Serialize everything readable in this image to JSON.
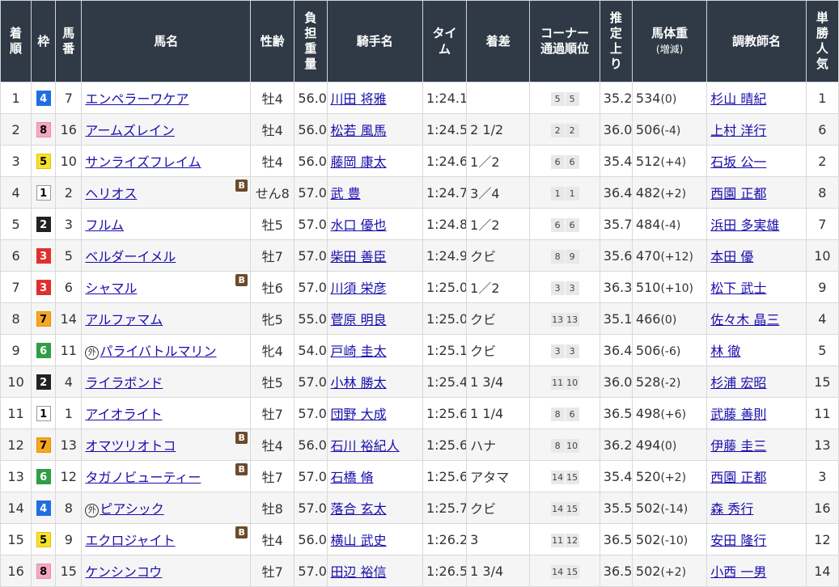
{
  "headers": {
    "rank": "着順",
    "waku": "枠",
    "num": "馬番",
    "horse": "馬名",
    "sexage": "性齢",
    "weight": "負担重量",
    "jockey": "騎手名",
    "time": "タイム",
    "margin": "着差",
    "corner_line1": "コーナー",
    "corner_line2": "通過順位",
    "last": "推定上り",
    "bw_line1": "馬体重",
    "bw_line2": "(増減)",
    "trainer": "調教師名",
    "pop": "単勝人気"
  },
  "colors": {
    "header_bg": "#2f3a46",
    "link": "#1a0dab",
    "blinker_bg": "#6b4a2b"
  },
  "rows": [
    {
      "rank": "1",
      "waku": "4",
      "num": "7",
      "horse": "エンペラーワケア",
      "blinker": "",
      "marker": "",
      "sexage": "牡4",
      "weight": "56.0",
      "jockey": "川田 将雅",
      "time": "1:24.1",
      "margin": "",
      "c1": "5",
      "c2": "5",
      "last": "35.2",
      "bw": "534",
      "bwc": "(0)",
      "trainer": "杉山 晴紀",
      "pop": "1"
    },
    {
      "rank": "2",
      "waku": "8",
      "num": "16",
      "horse": "アームズレイン",
      "blinker": "",
      "marker": "",
      "sexage": "牡4",
      "weight": "56.0",
      "jockey": "松若 風馬",
      "time": "1:24.5",
      "margin": "2 1/2",
      "c1": "2",
      "c2": "2",
      "last": "36.0",
      "bw": "506",
      "bwc": "(-4)",
      "trainer": "上村 洋行",
      "pop": "6"
    },
    {
      "rank": "3",
      "waku": "5",
      "num": "10",
      "horse": "サンライズフレイム",
      "blinker": "",
      "marker": "",
      "sexage": "牡4",
      "weight": "56.0",
      "jockey": "藤岡 康太",
      "time": "1:24.6",
      "margin": "1／2",
      "c1": "6",
      "c2": "6",
      "last": "35.4",
      "bw": "512",
      "bwc": "(+4)",
      "trainer": "石坂 公一",
      "pop": "2"
    },
    {
      "rank": "4",
      "waku": "1",
      "num": "2",
      "horse": "ヘリオス",
      "blinker": "B",
      "marker": "",
      "sexage": "せん8",
      "weight": "57.0",
      "jockey": "武 豊",
      "time": "1:24.7",
      "margin": "3／4",
      "c1": "1",
      "c2": "1",
      "last": "36.4",
      "bw": "482",
      "bwc": "(+2)",
      "trainer": "西園 正都",
      "pop": "8"
    },
    {
      "rank": "5",
      "waku": "2",
      "num": "3",
      "horse": "フルム",
      "blinker": "",
      "marker": "",
      "sexage": "牡5",
      "weight": "57.0",
      "jockey": "水口 優也",
      "time": "1:24.8",
      "margin": "1／2",
      "c1": "6",
      "c2": "6",
      "last": "35.7",
      "bw": "484",
      "bwc": "(-4)",
      "trainer": "浜田 多実雄",
      "pop": "7"
    },
    {
      "rank": "6",
      "waku": "3",
      "num": "5",
      "horse": "ベルダーイメル",
      "blinker": "",
      "marker": "",
      "sexage": "牡7",
      "weight": "57.0",
      "jockey": "柴田 善臣",
      "time": "1:24.9",
      "margin": "クビ",
      "c1": "8",
      "c2": "9",
      "last": "35.6",
      "bw": "470",
      "bwc": "(+12)",
      "trainer": "本田 優",
      "pop": "10"
    },
    {
      "rank": "7",
      "waku": "3",
      "num": "6",
      "horse": "シャマル",
      "blinker": "B",
      "marker": "",
      "sexage": "牡6",
      "weight": "57.0",
      "jockey": "川須 栄彦",
      "time": "1:25.0",
      "margin": "1／2",
      "c1": "3",
      "c2": "3",
      "last": "36.3",
      "bw": "510",
      "bwc": "(+10)",
      "trainer": "松下 武士",
      "pop": "9"
    },
    {
      "rank": "8",
      "waku": "7",
      "num": "14",
      "horse": "アルファマム",
      "blinker": "",
      "marker": "",
      "sexage": "牝5",
      "weight": "55.0",
      "jockey": "菅原 明良",
      "time": "1:25.0",
      "margin": "クビ",
      "c1": "13",
      "c2": "13",
      "last": "35.1",
      "bw": "466",
      "bwc": "(0)",
      "trainer": "佐々木 晶三",
      "pop": "4"
    },
    {
      "rank": "9",
      "waku": "6",
      "num": "11",
      "horse": "パライバトルマリン",
      "blinker": "",
      "marker": "外",
      "sexage": "牝4",
      "weight": "54.0",
      "jockey": "戸崎 圭太",
      "time": "1:25.1",
      "margin": "クビ",
      "c1": "3",
      "c2": "3",
      "last": "36.4",
      "bw": "506",
      "bwc": "(-6)",
      "trainer": "林 徹",
      "pop": "5"
    },
    {
      "rank": "10",
      "waku": "2",
      "num": "4",
      "horse": "ライラボンド",
      "blinker": "",
      "marker": "",
      "sexage": "牡5",
      "weight": "57.0",
      "jockey": "小林 勝太",
      "time": "1:25.4",
      "margin": "1 3/4",
      "c1": "11",
      "c2": "10",
      "last": "36.0",
      "bw": "528",
      "bwc": "(-2)",
      "trainer": "杉浦 宏昭",
      "pop": "15"
    },
    {
      "rank": "11",
      "waku": "1",
      "num": "1",
      "horse": "アイオライト",
      "blinker": "",
      "marker": "",
      "sexage": "牡7",
      "weight": "57.0",
      "jockey": "団野 大成",
      "time": "1:25.6",
      "margin": "1 1/4",
      "c1": "8",
      "c2": "6",
      "last": "36.5",
      "bw": "498",
      "bwc": "(+6)",
      "trainer": "武藤 善則",
      "pop": "11"
    },
    {
      "rank": "12",
      "waku": "7",
      "num": "13",
      "horse": "オマツリオトコ",
      "blinker": "B",
      "marker": "",
      "sexage": "牡4",
      "weight": "56.0",
      "jockey": "石川 裕紀人",
      "time": "1:25.6",
      "margin": "ハナ",
      "c1": "8",
      "c2": "10",
      "last": "36.2",
      "bw": "494",
      "bwc": "(0)",
      "trainer": "伊藤 圭三",
      "pop": "13"
    },
    {
      "rank": "13",
      "waku": "6",
      "num": "12",
      "horse": "タガノビューティー",
      "blinker": "B",
      "marker": "",
      "sexage": "牡7",
      "weight": "57.0",
      "jockey": "石橋 脩",
      "time": "1:25.6",
      "margin": "アタマ",
      "c1": "14",
      "c2": "15",
      "last": "35.4",
      "bw": "520",
      "bwc": "(+2)",
      "trainer": "西園 正都",
      "pop": "3"
    },
    {
      "rank": "14",
      "waku": "4",
      "num": "8",
      "horse": "ピアシック",
      "blinker": "",
      "marker": "外",
      "sexage": "牡8",
      "weight": "57.0",
      "jockey": "落合 玄太",
      "time": "1:25.7",
      "margin": "クビ",
      "c1": "14",
      "c2": "15",
      "last": "35.5",
      "bw": "502",
      "bwc": "(-14)",
      "trainer": "森 秀行",
      "pop": "16"
    },
    {
      "rank": "15",
      "waku": "5",
      "num": "9",
      "horse": "エクロジャイト",
      "blinker": "B",
      "marker": "",
      "sexage": "牡4",
      "weight": "56.0",
      "jockey": "横山 武史",
      "time": "1:26.2",
      "margin": "3",
      "c1": "11",
      "c2": "12",
      "last": "36.5",
      "bw": "502",
      "bwc": "(-10)",
      "trainer": "安田 隆行",
      "pop": "12"
    },
    {
      "rank": "16",
      "waku": "8",
      "num": "15",
      "horse": "ケンシンコウ",
      "blinker": "",
      "marker": "",
      "sexage": "牡7",
      "weight": "57.0",
      "jockey": "田辺 裕信",
      "time": "1:26.5",
      "margin": "1 3/4",
      "c1": "14",
      "c2": "15",
      "last": "36.5",
      "bw": "502",
      "bwc": "(+2)",
      "trainer": "小西 一男",
      "pop": "14"
    }
  ]
}
